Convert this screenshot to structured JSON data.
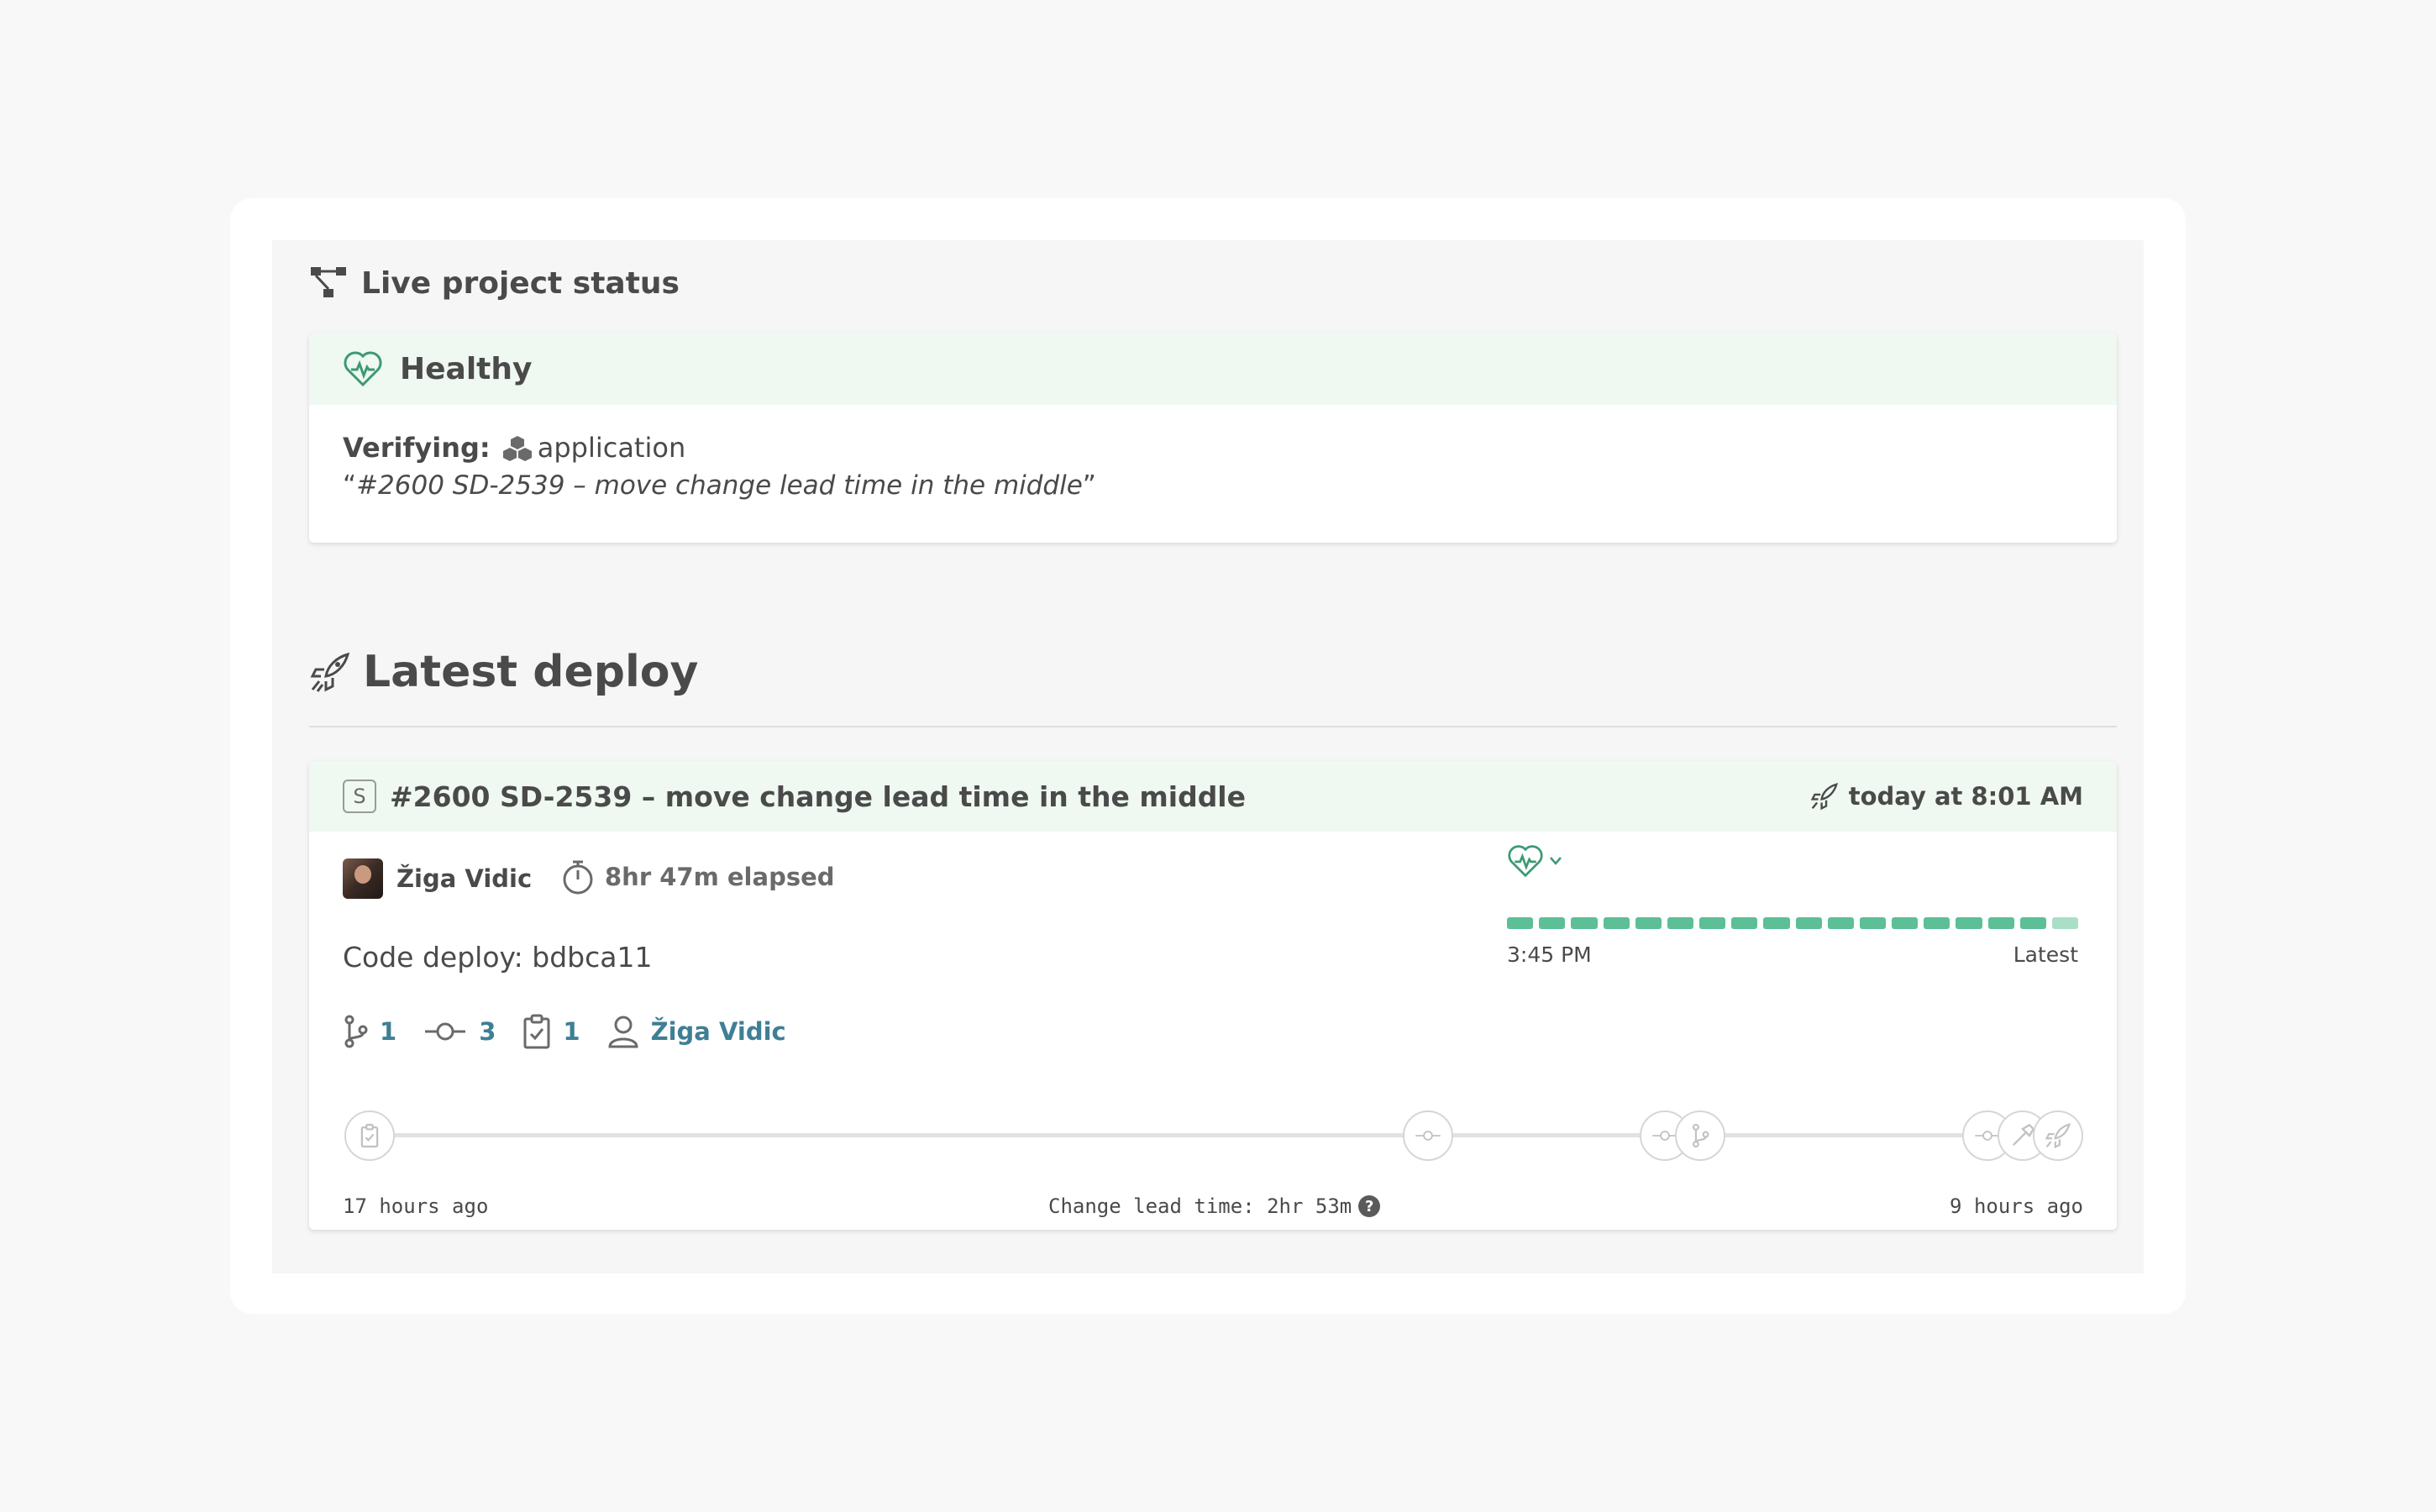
{
  "live_status": {
    "title": "Live project status",
    "health_label": "Healthy",
    "verifying_label": "Verifying:",
    "verifying_target": "application",
    "quote_open": "“",
    "quote_text": "#2600 SD-2539 – move change lead time in the middle",
    "quote_close": "”"
  },
  "latest_deploy": {
    "title": "Latest deploy",
    "badge": "S",
    "deploy_title": "#2600 SD-2539 – move change lead time in the middle",
    "deploy_time": "today at 8:01 AM",
    "author": "Žiga Vidic",
    "elapsed": "8hr 47m elapsed",
    "code_deploy": "Code deploy: bdbca11",
    "stats": {
      "pull_requests": "1",
      "commits": "3",
      "tasks": "1",
      "user": "Žiga Vidic"
    },
    "health": {
      "segments_total": 18,
      "segments_latest_light": 1,
      "start_label": "3:45 PM",
      "end_label": "Latest"
    },
    "timeline": {
      "start_label": "17 hours ago",
      "lead_time_label": "Change lead time: 2hr 53m",
      "end_label": "9 hours ago"
    }
  },
  "colors": {
    "accent_green": "#5cbf96",
    "light_green": "#a9dfc6",
    "header_green_bg": "#eff8f1",
    "link_blue": "#3e7f95"
  },
  "icons": {
    "live_status": "hierarchy-icon",
    "healthy": "heart-pulse-icon",
    "verifying": "boxes-icon",
    "latest_deploy": "rocket-icon",
    "elapsed": "stopwatch-icon",
    "pull_request": "git-branch-icon",
    "commit": "git-commit-icon",
    "task": "clipboard-check-icon",
    "user": "user-icon",
    "help": "question-circle-icon"
  }
}
